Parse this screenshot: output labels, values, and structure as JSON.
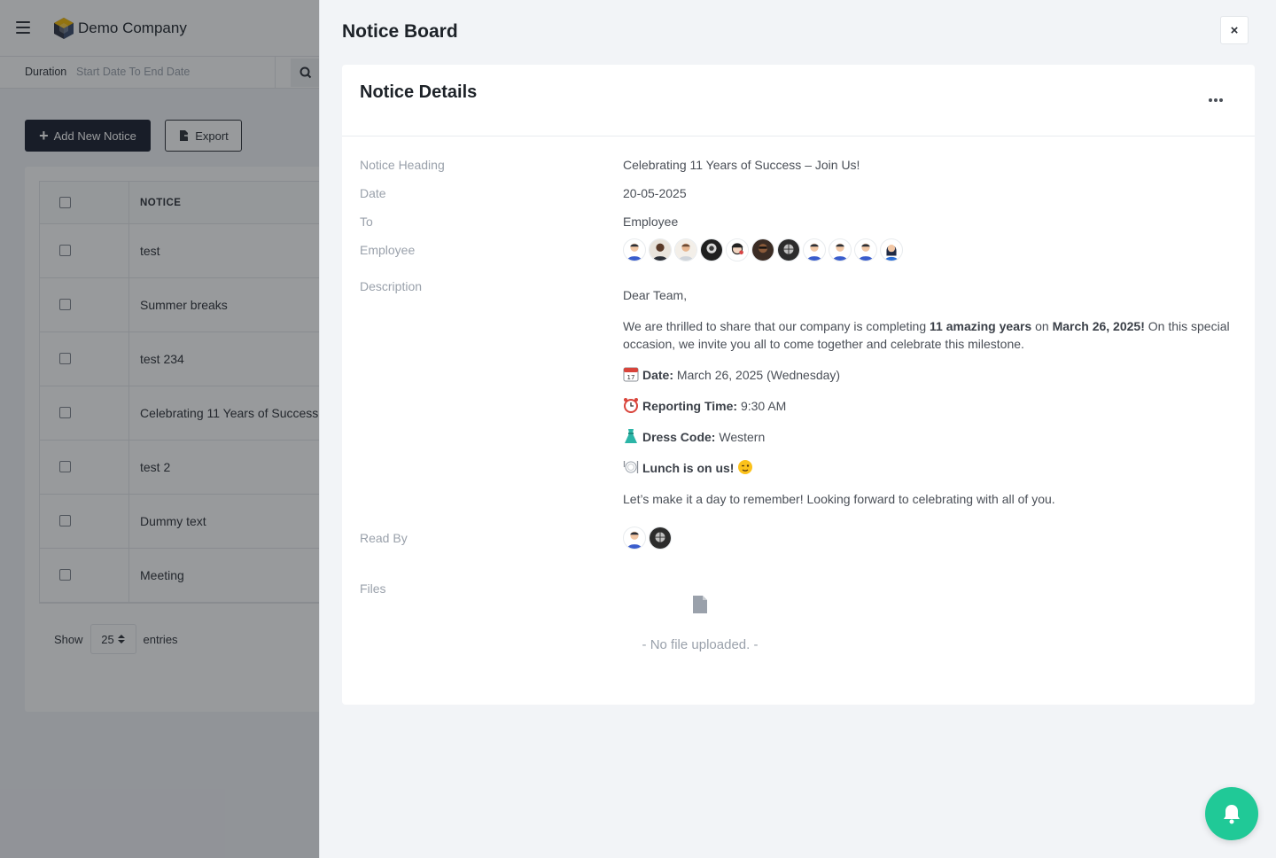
{
  "app": {
    "company_name": "Demo Company",
    "filter": {
      "duration_label": "Duration",
      "date_placeholder": "Start Date To End Date"
    },
    "buttons": {
      "add_new_notice": "Add New Notice",
      "export": "Export"
    },
    "table": {
      "header": "NOTICE",
      "rows": [
        "test",
        "Summer breaks",
        "test 234",
        "Celebrating 11 Years of Success",
        "test 2",
        "Dummy text",
        "Meeting"
      ]
    },
    "entries": {
      "show": "Show",
      "value": "25",
      "suffix": "entries"
    }
  },
  "drawer": {
    "title": "Notice Board",
    "close_label": "×",
    "card_title": "Notice Details",
    "fields": {
      "notice_heading_label": "Notice Heading",
      "notice_heading": "Celebrating 11 Years of Success – Join Us!",
      "date_label": "Date",
      "date": "20-05-2025",
      "to_label": "To",
      "to": "Employee",
      "employee_label": "Employee",
      "description_label": "Description",
      "read_by_label": "Read By",
      "files_label": "Files",
      "no_file": "- No file uploaded. -"
    },
    "description": {
      "greeting": "Dear Team,",
      "intro_1": "We are thrilled to share that our company is completing ",
      "intro_bold_1": "11 amazing years",
      "intro_2": " on ",
      "intro_bold_2": "March 26, 2025!",
      "intro_3": " On this special occasion, we invite you all to come together and celebrate this milestone.",
      "date_key": "Date:",
      "date_val": " March 26, 2025 (Wednesday)",
      "time_key": "Reporting Time:",
      "time_val": " 9:30 AM",
      "dress_key": "Dress Code:",
      "dress_val": " Western",
      "lunch": "Lunch is on us!",
      "closing": "Let’s make it a day to remember! Looking forward to celebrating with all of you."
    }
  },
  "icons": [
    "hamburger-icon",
    "search-icon",
    "plus-icon",
    "export-icon",
    "close-icon",
    "more-icon",
    "calendar-icon",
    "alarm-clock-icon",
    "dress-icon",
    "plate-icon",
    "wink-icon",
    "file-icon",
    "bell-icon"
  ],
  "colors": {
    "primary_dark": "#161c2d",
    "fab": "#20c997",
    "muted_text": "#9aa1ab"
  }
}
